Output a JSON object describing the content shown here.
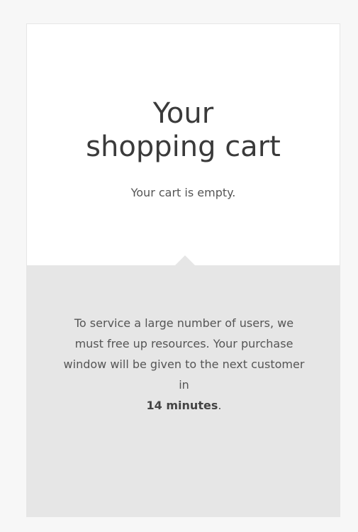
{
  "cart": {
    "title_line1": "Your",
    "title_line2": "shopping cart",
    "empty_message": "Your cart is empty."
  },
  "notice": {
    "text": "To service a large number of users, we must free up resources. Your purchase window will be given to the next customer in",
    "time_remaining": "14 minutes",
    "period": "."
  },
  "colors": {
    "page_background": "#f7f7f7",
    "card_background": "#ffffff",
    "notice_background": "#e6e6e6",
    "title_text": "#3a3a3a",
    "body_text": "#555555"
  }
}
